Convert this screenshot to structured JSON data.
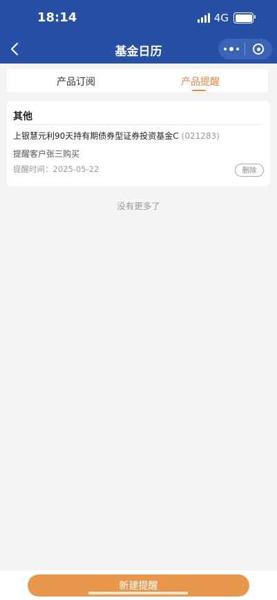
{
  "status_bar": {
    "time": "18:14",
    "network": "4G"
  },
  "nav": {
    "title": "基金日历"
  },
  "tabs": [
    {
      "label": "产品订阅",
      "active": false
    },
    {
      "label": "产品提醒",
      "active": true
    }
  ],
  "card": {
    "title": "其他",
    "fund_name": "上银慧元利90天持有期债券型证券投资基金C",
    "fund_code": "(021283)",
    "remark": "提醒客户张三购买",
    "remind_time": "提醒时间：2025-05-22",
    "delete_label": "删除"
  },
  "no_more": "没有更多了",
  "new_button": "新建提醒",
  "colors": {
    "brand": "#2650a5",
    "accent": "#e8843b",
    "button": "#e8974b"
  }
}
